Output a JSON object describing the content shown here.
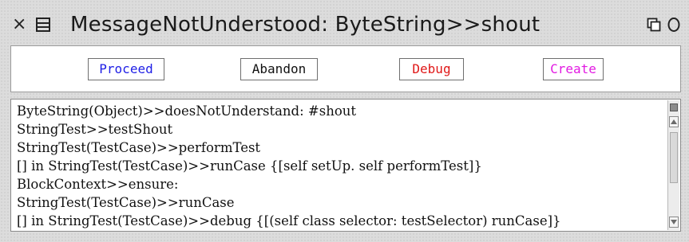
{
  "window": {
    "title": "MessageNotUnderstood: ByteString>>shout",
    "close_glyph": "×"
  },
  "buttons": {
    "proceed": "Proceed",
    "abandon": "Abandon",
    "debug": "Debug",
    "create": "Create"
  },
  "colors": {
    "proceed": "#1f1fe6",
    "abandon": "#111111",
    "debug": "#e01818",
    "create": "#e21ae2",
    "window_bg": "#dcdcdc"
  },
  "icons": {
    "close": "close-icon",
    "window_menu": "window-menu-icon",
    "collapse": "collapse-icon",
    "expand": "expand-icon",
    "scroll_menu": "scroll-menu-icon",
    "scroll_up": "scroll-up-icon",
    "scroll_down": "scroll-down-icon"
  },
  "stack": {
    "items": [
      "ByteString(Object)>>doesNotUnderstand: #shout",
      "StringTest>>testShout",
      "StringTest(TestCase)>>performTest",
      "[] in StringTest(TestCase)>>runCase {[self setUp.  self performTest]}",
      "BlockContext>>ensure:",
      "StringTest(TestCase)>>runCase",
      "[] in StringTest(TestCase)>>debug {[(self class selector: testSelector) runCase]}"
    ]
  }
}
